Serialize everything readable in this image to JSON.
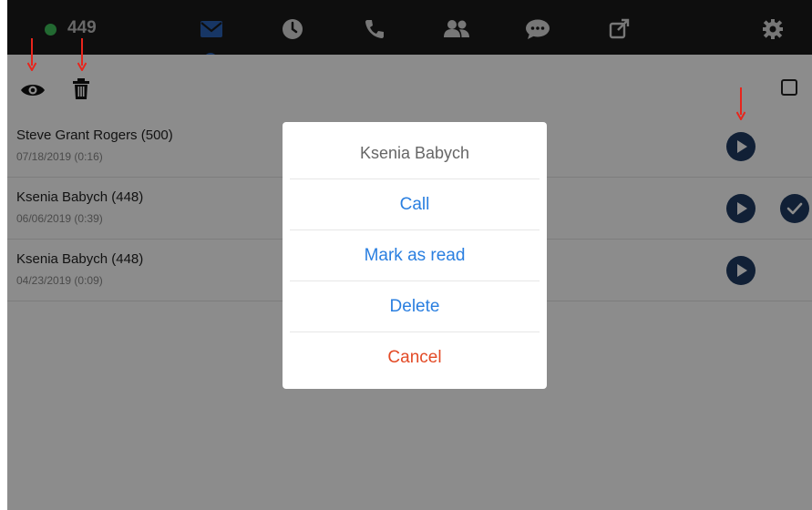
{
  "header": {
    "status_color": "#3fbf5a",
    "extension": "449",
    "nav": [
      {
        "icon": "envelope-icon",
        "active": true
      },
      {
        "icon": "clock-icon"
      },
      {
        "icon": "phone-icon"
      },
      {
        "icon": "contacts-icon"
      },
      {
        "icon": "chat-icon"
      },
      {
        "icon": "external-link-icon"
      },
      {
        "icon": "gear-icon"
      }
    ],
    "accent": "#2a63b8"
  },
  "toolbar": {
    "icons": [
      "eye-icon",
      "trash-icon",
      "select-all-checkbox"
    ]
  },
  "voicemails": [
    {
      "name": "Steve Grant Rogers (500)",
      "date": "07/18/2019 (0:16)",
      "read": false
    },
    {
      "name": "Ksenia Babych (448)",
      "date": "06/06/2019 (0:39)",
      "read": true
    },
    {
      "name": "Ksenia Babych (448)",
      "date": "04/23/2019 (0:09)",
      "read": false
    }
  ],
  "dialog": {
    "title": "Ksenia Babych",
    "options": [
      {
        "label": "Call",
        "color": "#2a7fe0"
      },
      {
        "label": "Mark as read",
        "color": "#2a7fe0"
      },
      {
        "label": "Delete",
        "color": "#2a7fe0"
      },
      {
        "label": "Cancel",
        "color": "#e34a26"
      }
    ]
  },
  "annotation_arrow_color": "#e8251c"
}
